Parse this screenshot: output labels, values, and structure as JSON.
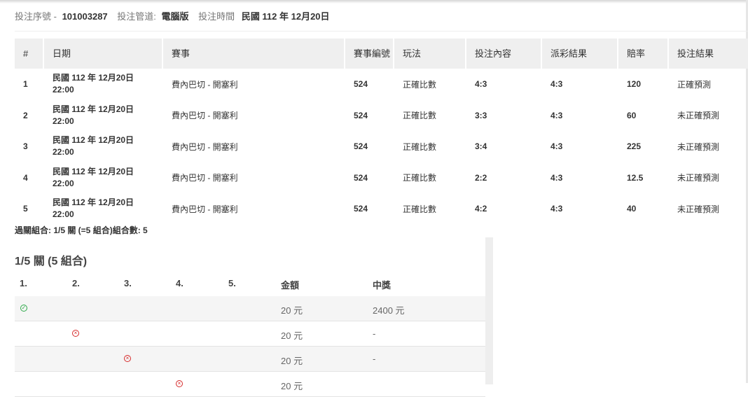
{
  "header": {
    "serial_label": "投注序號 -",
    "serial_value": "101003287",
    "channel_label": "投注管道:",
    "channel_value": "電腦版",
    "time_label": "投注時間",
    "time_value": "民國 112 年 12月20日"
  },
  "bets_table": {
    "columns": [
      "#",
      "日期",
      "賽事",
      "賽事編號",
      "玩法",
      "投注內容",
      "派彩結果",
      "賠率",
      "投注結果"
    ],
    "rows": [
      {
        "no": "1",
        "date_line1": "民國 112 年 12月20日",
        "date_line2": "22:00",
        "match": "費內巴切 - 開塞利",
        "match_no": "524",
        "play": "正確比數",
        "bet": "4:3",
        "payout": "4:3",
        "odds": "120",
        "result": "正確預測"
      },
      {
        "no": "2",
        "date_line1": "民國 112 年 12月20日",
        "date_line2": "22:00",
        "match": "費內巴切 - 開塞利",
        "match_no": "524",
        "play": "正確比數",
        "bet": "3:3",
        "payout": "4:3",
        "odds": "60",
        "result": "未正確預測"
      },
      {
        "no": "3",
        "date_line1": "民國 112 年 12月20日",
        "date_line2": "22:00",
        "match": "費內巴切 - 開塞利",
        "match_no": "524",
        "play": "正確比數",
        "bet": "3:4",
        "payout": "4:3",
        "odds": "225",
        "result": "未正確預測"
      },
      {
        "no": "4",
        "date_line1": "民國 112 年 12月20日",
        "date_line2": "22:00",
        "match": "費內巴切 - 開塞利",
        "match_no": "524",
        "play": "正確比數",
        "bet": "2:2",
        "payout": "4:3",
        "odds": "12.5",
        "result": "未正確預測"
      },
      {
        "no": "5",
        "date_line1": "民國 112 年 12月20日",
        "date_line2": "22:00",
        "match": "費內巴切 - 開塞利",
        "match_no": "524",
        "play": "正確比數",
        "bet": "4:2",
        "payout": "4:3",
        "odds": "40",
        "result": "未正確預測"
      }
    ]
  },
  "parlay_note": "過關組合: 1/5 關 (=5 組合)組合數: 5",
  "combo_panel": {
    "title": "1/5 關 (5 組合)",
    "columns": [
      "1.",
      "2.",
      "3.",
      "4.",
      "5.",
      "金額",
      "中獎"
    ],
    "rows": [
      {
        "mark_col": 1,
        "mark": "win",
        "amount": "20 元",
        "prize": "2400 元"
      },
      {
        "mark_col": 2,
        "mark": "loss",
        "amount": "20 元",
        "prize": "-"
      },
      {
        "mark_col": 3,
        "mark": "loss",
        "amount": "20 元",
        "prize": "-"
      },
      {
        "mark_col": 4,
        "mark": "loss",
        "amount": "20 元",
        "prize": ""
      }
    ]
  },
  "colors": {
    "win": "#2eaa4a",
    "loss": "#d62b2b",
    "header_bg": "#efefef"
  },
  "icons": {
    "win": "check-circle-icon",
    "loss": "x-circle-icon"
  }
}
